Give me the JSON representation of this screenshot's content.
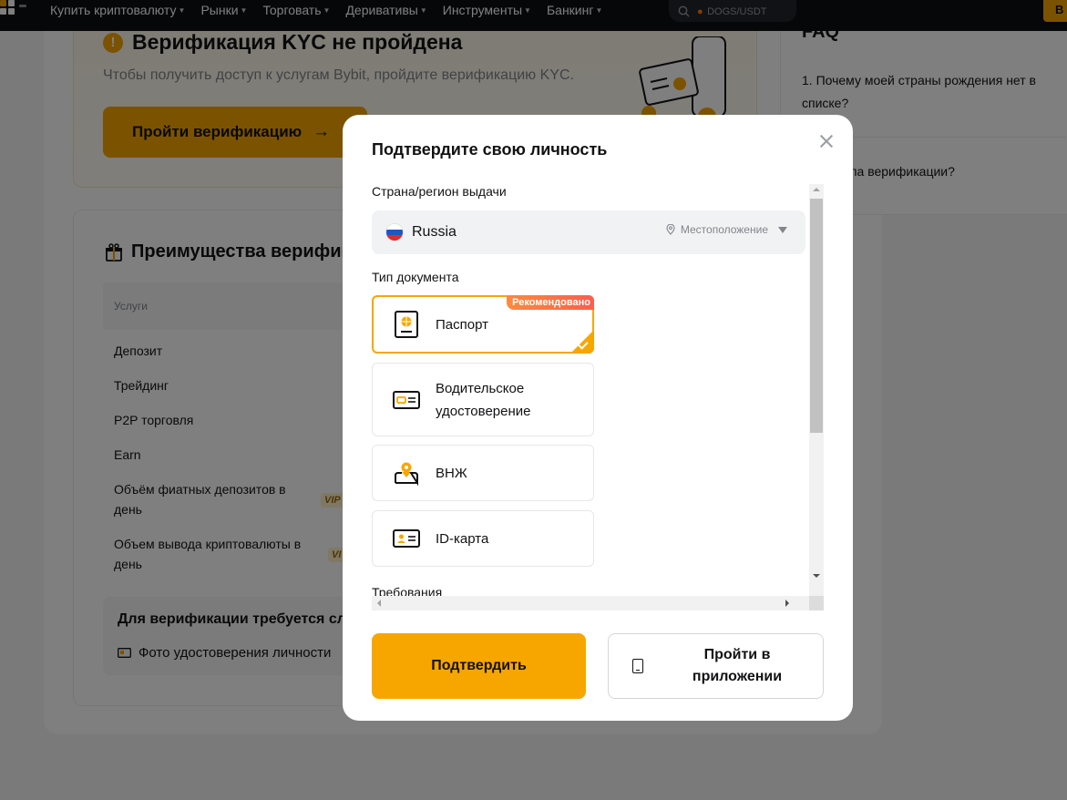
{
  "nav": {
    "items": [
      {
        "label": "Купить криптовалюту"
      },
      {
        "label": "Рынки"
      },
      {
        "label": "Торговать"
      },
      {
        "label": "Деривативы"
      },
      {
        "label": "Инструменты"
      },
      {
        "label": "Банкинг"
      }
    ],
    "search_placeholder": "DOGS/USDT",
    "right_button": "B"
  },
  "kyc": {
    "title": "Верификация KYC не пройдена",
    "subtitle": "Чтобы получить доступ к услугам Bybit, пройдите верификацию KYC.",
    "button": "Пройти верификацию"
  },
  "faq": {
    "title": "FAQ",
    "q1": "1. Почему моей страны рождения нет в списке?",
    "q2": "ы правила верификации?"
  },
  "benefits": {
    "title": "Преимущества верифик",
    "col_services": "Услуги",
    "rows": [
      {
        "label": "Депозит"
      },
      {
        "label": "Трейдинг"
      },
      {
        "label": "P2P торговля"
      },
      {
        "label": "Earn"
      },
      {
        "label": "Объём фиатных депозитов в день"
      },
      {
        "label": "Объем вывода криптовалюты в день"
      }
    ],
    "vip1": "VIP",
    "vip2": "VI",
    "req_title": "Для верификации требуется сле",
    "req_item": "Фото удостоверения личности"
  },
  "modal": {
    "title": "Подтвердите свою личность",
    "country_label": "Страна/регион выдачи",
    "country_value": "Russia",
    "location_label": "Местоположение",
    "doc_type_label": "Тип документа",
    "recommended_badge": "Рекомендовано",
    "documents": [
      {
        "label": "Паспорт",
        "icon": "passport-icon",
        "selected": true
      },
      {
        "label": "Водительское удостоверение",
        "icon": "driver-license-icon",
        "selected": false
      },
      {
        "label": "ВНЖ",
        "icon": "residence-permit-icon",
        "selected": false
      },
      {
        "label": "ID-карта",
        "icon": "id-card-icon",
        "selected": false
      }
    ],
    "requirements_label": "Требования",
    "confirm_button": "Подтвердить",
    "app_button": "Пройти в приложении"
  },
  "colors": {
    "accent": "#f7a600",
    "badge_gradient_start": "#ff8a3d",
    "badge_gradient_end": "#ff5d4f",
    "nav_bg": "#0c0e12"
  }
}
